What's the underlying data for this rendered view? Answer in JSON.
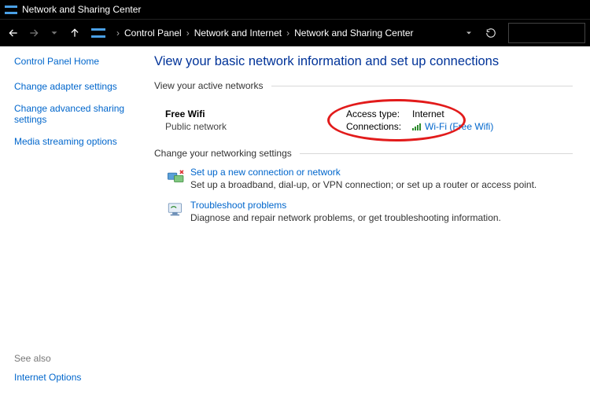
{
  "window": {
    "title": "Network and Sharing Center"
  },
  "breadcrumb": {
    "items": [
      "Control Panel",
      "Network and Internet",
      "Network and Sharing Center"
    ]
  },
  "sidebar": {
    "home": "Control Panel Home",
    "items": [
      "Change adapter settings",
      "Change advanced sharing settings",
      "Media streaming options"
    ],
    "see_also_hdr": "See also",
    "see_also": [
      "Internet Options"
    ]
  },
  "main": {
    "heading": "View your basic network information and set up connections",
    "active_hdr": "View your active networks",
    "network": {
      "name": "Free Wifi",
      "type": "Public network",
      "access_label": "Access type:",
      "access_value": "Internet",
      "conn_label": "Connections:",
      "conn_link": "Wi-Fi (Free Wifi)"
    },
    "change_hdr": "Change your networking settings",
    "tasks": [
      {
        "title": "Set up a new connection or network",
        "desc": "Set up a broadband, dial-up, or VPN connection; or set up a router or access point."
      },
      {
        "title": "Troubleshoot problems",
        "desc": "Diagnose and repair network problems, or get troubleshooting information."
      }
    ]
  }
}
